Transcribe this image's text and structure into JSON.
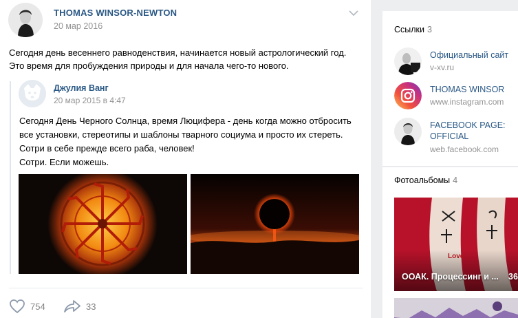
{
  "post": {
    "author": "THOMAS WINSOR-NEWTON",
    "date": "20 мар 2016",
    "text": [
      "Сегодня день весеннего равноденствия, начинается новый астрологический год.",
      "Это время для пробуждения природы и для начала чего-то нового."
    ],
    "quote": {
      "author": "Джулия Ванг",
      "date": "20 мар 2015 в 4:47",
      "text": [
        "Сегодня День Черного Солнца, время Люцифера - день когда можно отбросить",
        "все установки, стереотипы и шаблоны тварного социума и просто их стереть.",
        "Сотри в себе прежде всего раба, человек!",
        "Сотри. Если можешь."
      ]
    },
    "likes": "754",
    "shares": "33"
  },
  "sidebar": {
    "links": {
      "title": "Ссылки",
      "count": "3",
      "items": [
        {
          "title": "Официальный сайт",
          "url": "v-xv.ru",
          "icon": "site-avatar"
        },
        {
          "title": "THOMAS WINSOR",
          "url": "www.instagram.com",
          "icon": "instagram-icon"
        },
        {
          "title": "FACEBOOK PAGE:",
          "title2": "OFFICIAL",
          "url": "web.facebook.com",
          "icon": "facebook-avatar"
        }
      ]
    },
    "albums": {
      "title": "Фотоальбомы",
      "count": "4",
      "items": [
        {
          "caption": "ООАК. Процессинг и ...",
          "count": "36"
        }
      ]
    }
  },
  "colors": {
    "link": "#2a5885",
    "muted": "#939393",
    "page_bg": "#edeef0"
  }
}
